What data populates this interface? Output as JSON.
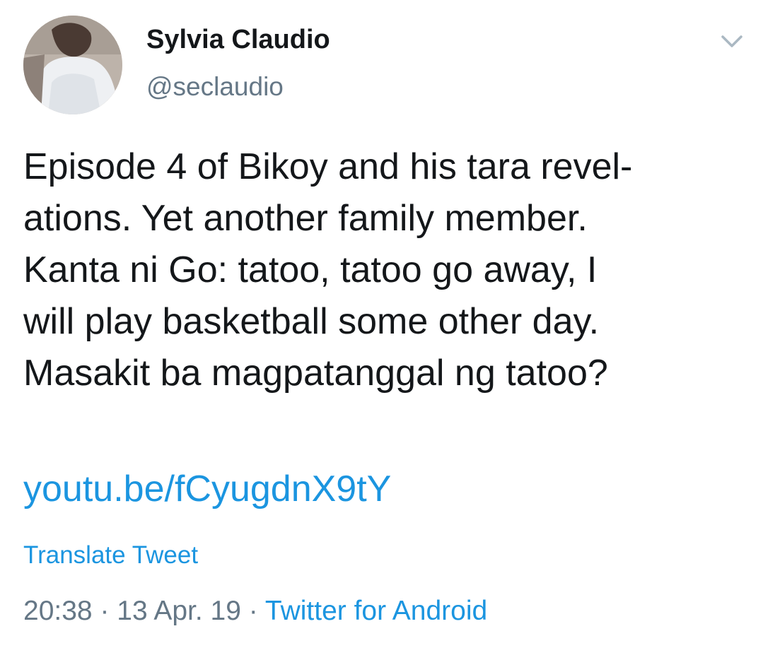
{
  "author": {
    "display_name": "Sylvia Claudio",
    "handle": "@seclaudio",
    "avatar_icon": "profile-photo"
  },
  "tweet": {
    "lines": [
      "Episode 4 of Bikoy and his tara revel-",
      "ations. Yet another family member.",
      "Kanta ni Go: tatoo, tatoo go away, I",
      "will play basketball some other day.",
      "Masakit ba magpatanggal ng tatoo?"
    ],
    "link": "youtu.be/fCyugdnX9tY",
    "translate_label": "Translate Tweet"
  },
  "meta": {
    "time": "20:38",
    "separator": " · ",
    "date": "13 Apr. 19",
    "source": "Twitter for Android"
  },
  "menu": {
    "icon": "chevron-down-icon"
  },
  "colors": {
    "link": "#1b95e0",
    "secondary": "#657786",
    "text": "#14171a"
  }
}
